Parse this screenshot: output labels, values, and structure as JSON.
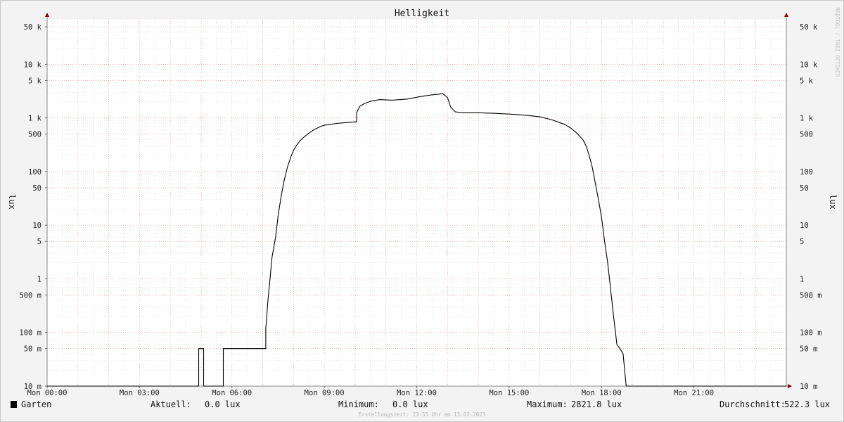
{
  "chart_data": {
    "type": "line",
    "title": "Helligkeit",
    "ylabel": "lux",
    "watermark": "RRDTOOL / TOBI OETIKER",
    "y_scale": "log",
    "ylim": [
      0.01,
      70000
    ],
    "y_ticks": [
      {
        "value": 50000,
        "label": "50 k"
      },
      {
        "value": 10000,
        "label": "10 k"
      },
      {
        "value": 5000,
        "label": "5 k"
      },
      {
        "value": 1000,
        "label": "1 k"
      },
      {
        "value": 500,
        "label": "500"
      },
      {
        "value": 100,
        "label": "100"
      },
      {
        "value": 50,
        "label": "50"
      },
      {
        "value": 10,
        "label": "10"
      },
      {
        "value": 5,
        "label": "5"
      },
      {
        "value": 1,
        "label": "1"
      },
      {
        "value": 0.5,
        "label": "500 m"
      },
      {
        "value": 0.1,
        "label": "100 m"
      },
      {
        "value": 0.05,
        "label": "50 m"
      },
      {
        "value": 0.01,
        "label": "10 m"
      }
    ],
    "x_unit": "hours",
    "xlim": [
      0,
      24
    ],
    "x_ticks": [
      {
        "value": 0,
        "label": "Mon 00:00"
      },
      {
        "value": 3,
        "label": "Mon 03:00"
      },
      {
        "value": 6,
        "label": "Mon 06:00"
      },
      {
        "value": 9,
        "label": "Mon 09:00"
      },
      {
        "value": 12,
        "label": "Mon 12:00"
      },
      {
        "value": 15,
        "label": "Mon 15:00"
      },
      {
        "value": 18,
        "label": "Mon 18:00"
      },
      {
        "value": 21,
        "label": "Mon 21:00"
      }
    ],
    "grid": true,
    "series": [
      {
        "name": "Garten",
        "color": "#000000",
        "x": [
          0,
          4.92,
          4.92,
          5.08,
          5.08,
          5.72,
          5.72,
          7.1,
          7.1,
          7.17,
          7.25,
          7.3,
          7.42,
          7.5,
          7.6,
          7.7,
          7.8,
          7.9,
          8.0,
          8.1,
          8.2,
          8.3,
          8.4,
          8.5,
          8.6,
          8.7,
          8.8,
          8.9,
          9.0,
          9.2,
          9.4,
          9.6,
          9.8,
          10.05,
          10.05,
          10.15,
          10.3,
          10.5,
          10.8,
          11.2,
          11.7,
          12.1,
          12.5,
          12.85,
          13.0,
          13.1,
          13.25,
          13.5,
          14.0,
          14.5,
          15.0,
          15.5,
          16.0,
          16.4,
          16.8,
          17.0,
          17.2,
          17.4,
          17.5,
          17.6,
          17.7,
          17.8,
          17.9,
          18.0,
          18.1,
          18.2,
          18.3,
          18.4,
          18.5,
          18.6,
          18.7,
          18.8,
          18.9,
          18.9,
          19.5,
          24
        ],
        "y": [
          0.01,
          0.01,
          0.05,
          0.05,
          0.01,
          0.01,
          0.05,
          0.05,
          0.12,
          0.4,
          1.2,
          2.5,
          6,
          15,
          35,
          70,
          120,
          180,
          250,
          310,
          370,
          420,
          470,
          520,
          570,
          620,
          660,
          700,
          730,
          760,
          790,
          810,
          830,
          850,
          1250,
          1650,
          1850,
          2050,
          2200,
          2150,
          2250,
          2500,
          2700,
          2821.8,
          2400,
          1600,
          1300,
          1250,
          1250,
          1220,
          1180,
          1130,
          1050,
          920,
          760,
          650,
          520,
          390,
          300,
          200,
          120,
          60,
          30,
          14,
          5,
          2,
          0.6,
          0.18,
          0.06,
          0.05,
          0.04,
          0.01,
          0.01,
          0,
          0,
          0
        ]
      }
    ],
    "legend": {
      "placement": "bottom",
      "series_name": "Garten",
      "current_label": "Aktuell:",
      "current_value": "0.0 lux",
      "min_label": "Minimum:",
      "min_value": "0.0 lux",
      "max_label": "Maximum:",
      "max_value": "2821.8 lux",
      "avg_label": "Durchschnitt:",
      "avg_value": "522.3 lux"
    },
    "footer": "Erstellungszeit: 23:55 Uhr am 13.02.2023"
  }
}
